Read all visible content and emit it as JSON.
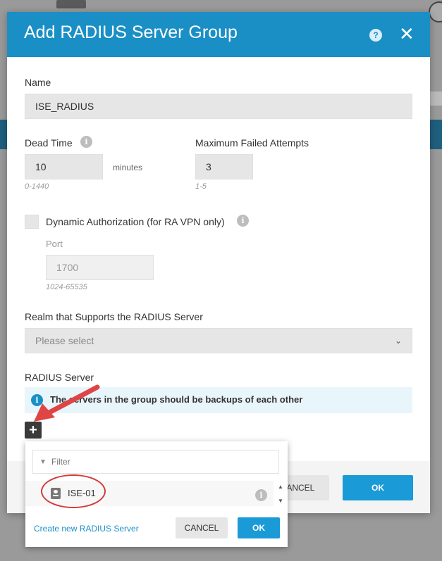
{
  "dialog": {
    "title": "Add RADIUS Server Group",
    "help_icon": "?",
    "close_icon": "✕"
  },
  "form": {
    "name_label": "Name",
    "name_value": "ISE_RADIUS",
    "dead_time_label": "Dead Time",
    "dead_time_value": "10",
    "dead_time_unit": "minutes",
    "dead_time_hint": "0-1440",
    "max_failed_label": "Maximum Failed Attempts",
    "max_failed_value": "3",
    "max_failed_hint": "1-5",
    "dynamic_auth_label": "Dynamic Authorization (for RA VPN only)",
    "port_label": "Port",
    "port_value": "1700",
    "port_hint": "1024-65535",
    "realm_label": "Realm that Supports the RADIUS Server",
    "realm_placeholder": "Please select",
    "radius_server_label": "RADIUS Server",
    "radius_banner": "The servers in the group should be backups of each other",
    "add_icon": "+"
  },
  "footer": {
    "cancel_label": "CANCEL",
    "ok_label": "OK"
  },
  "popup": {
    "filter_placeholder": "Filter",
    "items": [
      {
        "label": "ISE-01"
      }
    ],
    "create_link": "Create new RADIUS Server",
    "cancel_label": "CANCEL",
    "ok_label": "OK"
  },
  "icons": {
    "info": "i"
  },
  "colors": {
    "header_blue": "#1a8fc6",
    "ok_button": "#1a9ad6",
    "annotation_red": "#d43a3a"
  }
}
